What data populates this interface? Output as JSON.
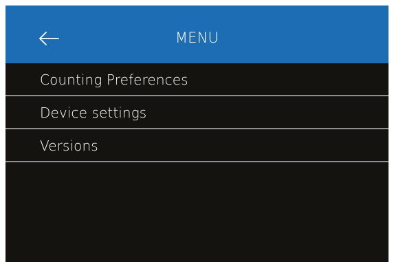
{
  "header": {
    "title": "MENU",
    "back_icon": "arrow-left-icon",
    "background_color": "#1d6db4"
  },
  "menu": {
    "items": [
      {
        "label": "Counting Preferences"
      },
      {
        "label": "Device settings"
      },
      {
        "label": "Versions"
      }
    ]
  },
  "colors": {
    "screen_background": "#15130f",
    "divider": "#8f8f8f",
    "text": "#ffffff"
  }
}
